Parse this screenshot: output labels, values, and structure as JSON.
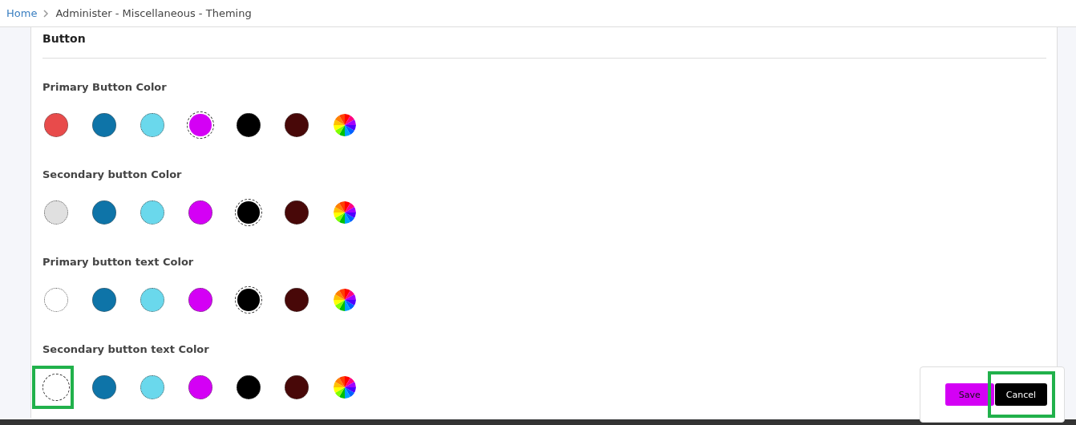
{
  "breadcrumb": {
    "home": "Home",
    "current": "Administer - Miscellaneous - Theming"
  },
  "card": {
    "title": "Button"
  },
  "groups": [
    {
      "label": "Primary Button Color",
      "swatches": [
        {
          "kind": "color",
          "color": "#e84b4b",
          "selected": false,
          "highlighted": false
        },
        {
          "kind": "color",
          "color": "#0e74a8",
          "selected": false,
          "highlighted": false
        },
        {
          "kind": "color",
          "color": "#6ad8ec",
          "selected": false,
          "highlighted": false
        },
        {
          "kind": "color",
          "color": "#d400f5",
          "selected": true,
          "highlighted": false
        },
        {
          "kind": "color",
          "color": "#000000",
          "selected": false,
          "highlighted": false
        },
        {
          "kind": "color",
          "color": "#480808",
          "selected": false,
          "highlighted": false
        },
        {
          "kind": "custom",
          "selected": false,
          "highlighted": false
        }
      ]
    },
    {
      "label": "Secondary button Color",
      "swatches": [
        {
          "kind": "color",
          "color": "#e0e0e0",
          "selected": false,
          "highlighted": false
        },
        {
          "kind": "color",
          "color": "#0e74a8",
          "selected": false,
          "highlighted": false
        },
        {
          "kind": "color",
          "color": "#6ad8ec",
          "selected": false,
          "highlighted": false
        },
        {
          "kind": "color",
          "color": "#d400f5",
          "selected": false,
          "highlighted": false
        },
        {
          "kind": "color",
          "color": "#000000",
          "selected": true,
          "highlighted": false
        },
        {
          "kind": "color",
          "color": "#480808",
          "selected": false,
          "highlighted": false
        },
        {
          "kind": "custom",
          "selected": false,
          "highlighted": false
        }
      ]
    },
    {
      "label": "Primary button text Color",
      "swatches": [
        {
          "kind": "color",
          "color": "#ffffff",
          "selected": false,
          "highlighted": false
        },
        {
          "kind": "color",
          "color": "#0e74a8",
          "selected": false,
          "highlighted": false
        },
        {
          "kind": "color",
          "color": "#6ad8ec",
          "selected": false,
          "highlighted": false
        },
        {
          "kind": "color",
          "color": "#d400f5",
          "selected": false,
          "highlighted": false
        },
        {
          "kind": "color",
          "color": "#000000",
          "selected": true,
          "highlighted": false
        },
        {
          "kind": "color",
          "color": "#480808",
          "selected": false,
          "highlighted": false
        },
        {
          "kind": "custom",
          "selected": false,
          "highlighted": false
        }
      ]
    },
    {
      "label": "Secondary button text Color",
      "swatches": [
        {
          "kind": "color",
          "color": "#ffffff",
          "selected": true,
          "highlighted": true
        },
        {
          "kind": "color",
          "color": "#0e74a8",
          "selected": false,
          "highlighted": false
        },
        {
          "kind": "color",
          "color": "#6ad8ec",
          "selected": false,
          "highlighted": false
        },
        {
          "kind": "color",
          "color": "#d400f5",
          "selected": false,
          "highlighted": false
        },
        {
          "kind": "color",
          "color": "#000000",
          "selected": false,
          "highlighted": false
        },
        {
          "kind": "color",
          "color": "#480808",
          "selected": false,
          "highlighted": false
        },
        {
          "kind": "custom",
          "selected": false,
          "highlighted": false
        }
      ]
    }
  ],
  "actions": [
    {
      "label": "Save",
      "color": "#d400f5",
      "highlighted": false
    },
    {
      "label": "Cancel",
      "color": "#000000",
      "highlighted": true
    }
  ]
}
